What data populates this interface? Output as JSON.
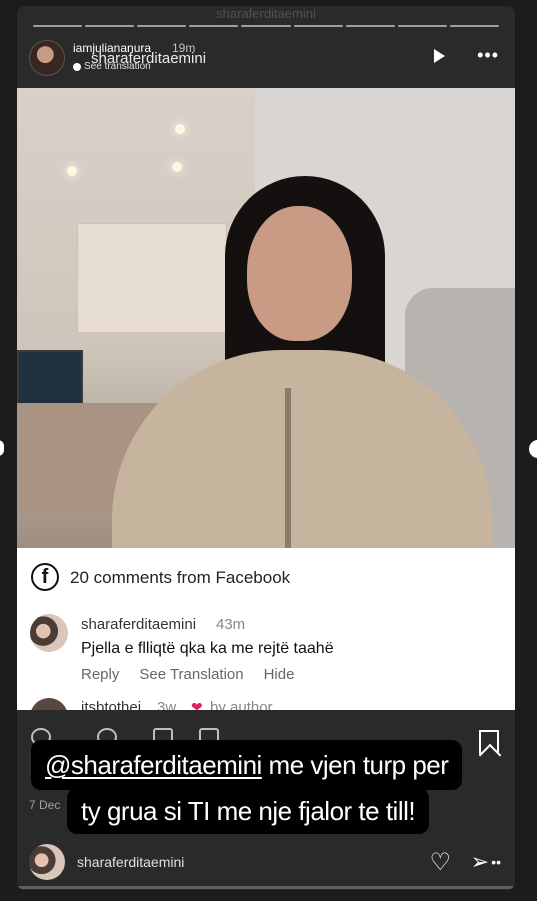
{
  "ghost_top_username": "sharaferditaemini",
  "header": {
    "username": "iamjuliananura",
    "time": "19m",
    "sub_text": "See translation",
    "overlay_username": "sharaferditaemini"
  },
  "comments_card": {
    "title": "20 comments from Facebook",
    "comments": [
      {
        "username": "sharaferditaemini",
        "time": "43m",
        "text": "Pjella e flliqtë qka ka me rejtë taahë",
        "actions": [
          "Reply",
          "See Translation",
          "Hide"
        ]
      },
      {
        "username": "itsbtothei",
        "time": "3w",
        "author_badge": "by author"
      }
    ]
  },
  "overlay_caption": {
    "mention": "@sharaferditaemini",
    "line1_rest": " me vjen turp per",
    "line2": "ty grua si TI me nje fjalor te till!"
  },
  "date_text": "7 Dec",
  "footer": {
    "username": "sharaferditaemini"
  },
  "icons": {
    "play": "play-icon",
    "more": "more-icon",
    "facebook": "facebook-icon",
    "bookmark": "bookmark-icon",
    "heart": "heart-icon",
    "send": "send-icon"
  }
}
